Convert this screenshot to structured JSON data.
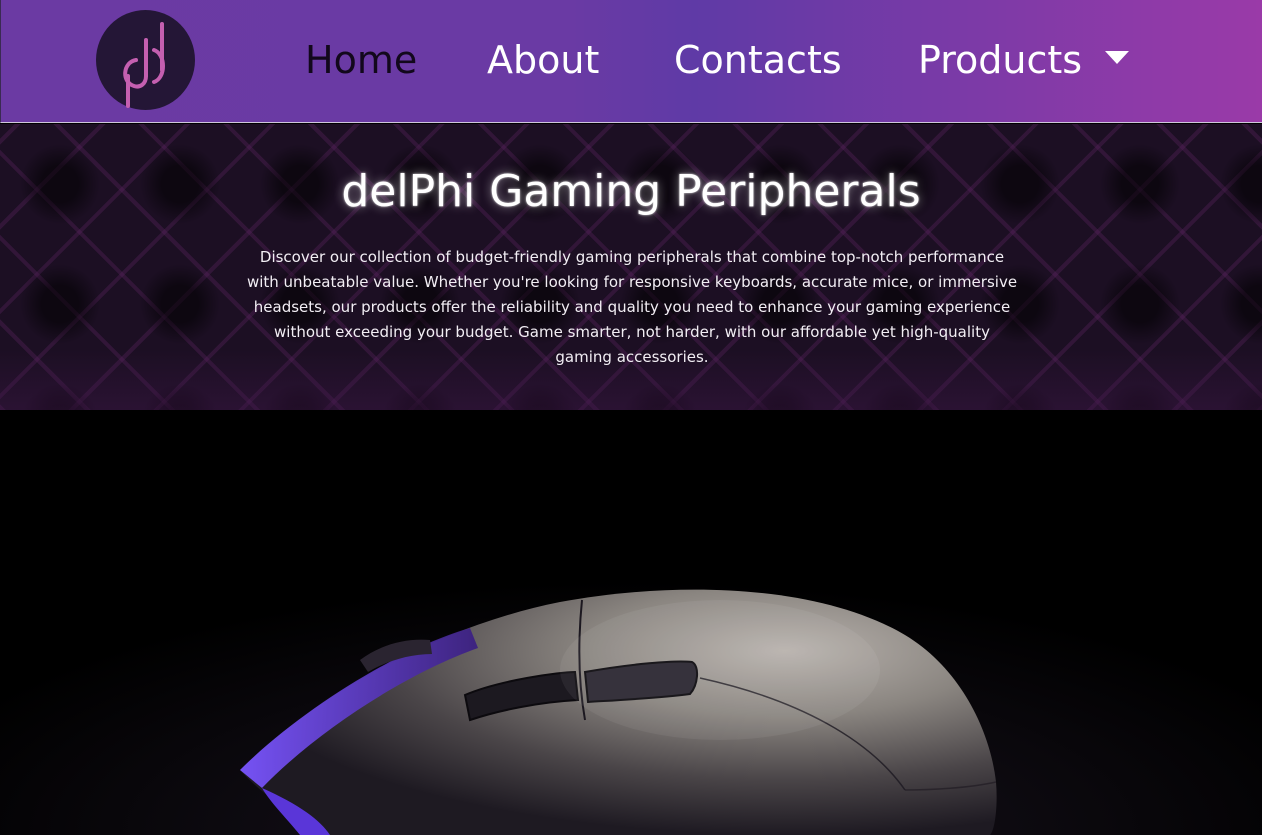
{
  "nav": {
    "items": [
      {
        "label": "Home",
        "active": true
      },
      {
        "label": "About",
        "active": false
      },
      {
        "label": "Contacts",
        "active": false
      },
      {
        "label": "Products",
        "active": false,
        "has_dropdown": true
      }
    ],
    "logo_icon": "power-d-logo-icon",
    "dropdown_icon": "caret-down-icon"
  },
  "hero": {
    "title": "delPhi Gaming Peripherals",
    "description": "Discover our collection of budget-friendly gaming peripherals that combine top-notch performance with unbeatable value. Whether you're looking for responsive keyboards, accurate mice, or immersive headsets, our products offer the reliability and quality you need to enhance your gaming experience without exceeding your budget. Game smarter, not harder, with our affordable yet high-quality gaming accessories."
  },
  "showcase": {
    "image": "gaming-mouse-product-image"
  },
  "colors": {
    "nav_gradient_start": "#6b3aa3",
    "nav_gradient_end": "#9a3aa8",
    "logo_bg": "#241636",
    "logo_accent": "#c45fb0",
    "active_nav_text": "#12081c",
    "nav_text": "#ffffff",
    "hero_bg": "#1c0f23",
    "mouse_accent": "#6a3cf0"
  }
}
